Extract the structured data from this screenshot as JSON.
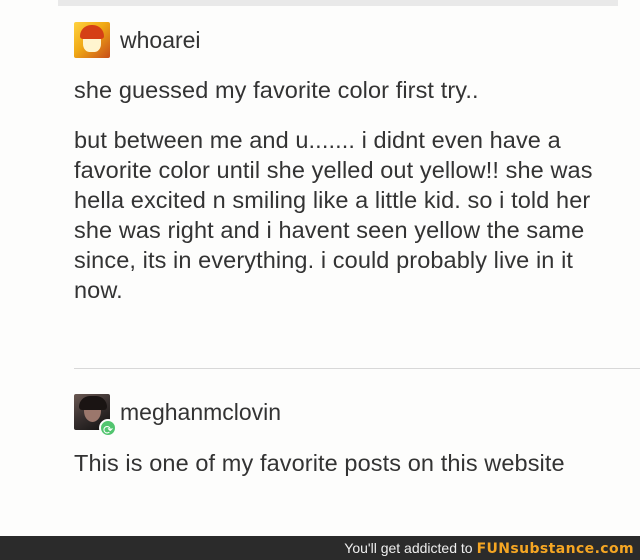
{
  "posts": [
    {
      "username": "whoarei",
      "avatar_icon": "user-avatar-icon",
      "paragraphs": [
        "she guessed my favorite color first try..",
        "but between me and u....... i didnt even have a favorite color until she yelled out yellow!! she was hella excited n smiling like a little kid. so i told her she was right and i havent seen yellow the same since, its in everything. i could probably live in it now."
      ]
    },
    {
      "username": "meghanmclovin",
      "avatar_icon": "user-avatar-icon",
      "badge_icon": "reblog-icon",
      "text": "This is one of my favorite posts on this website"
    }
  ],
  "footer": {
    "text": "You'll get addicted to ",
    "brand": "FUNsubstance.com"
  },
  "colors": {
    "background": "#fdfdfc",
    "text": "#333333",
    "footer_background": "#2b2b2b",
    "brand_accent": "#f5a623",
    "reblog_badge": "#52c56f"
  }
}
